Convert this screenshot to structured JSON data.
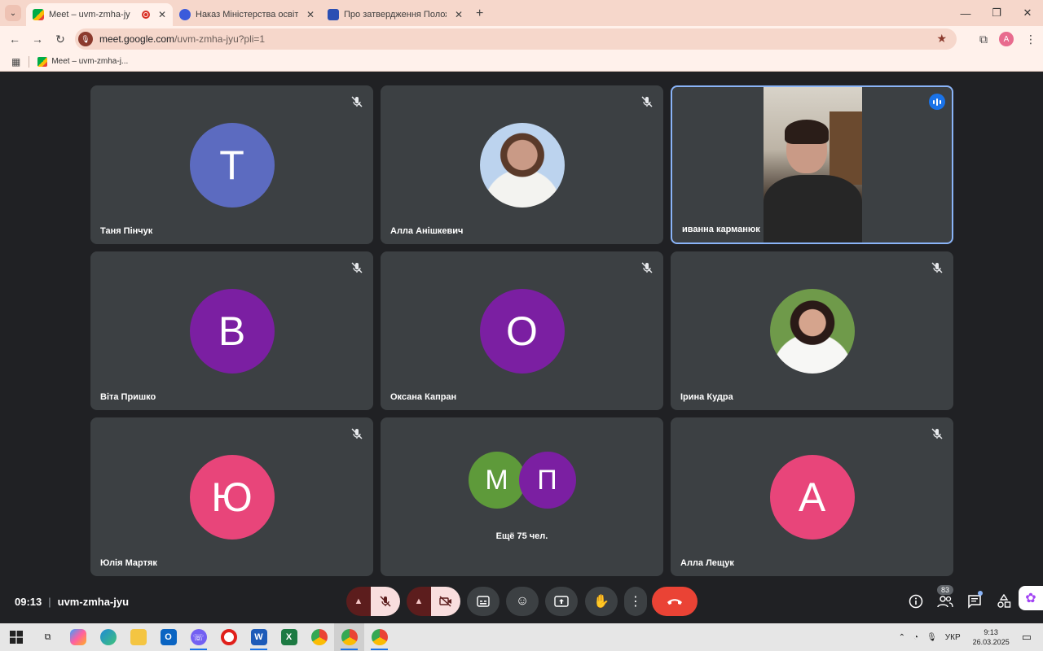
{
  "browser": {
    "tabs": [
      {
        "title": "Meet – uvm-zmha-jyu",
        "active": true,
        "favicon_color": "#00ac47"
      },
      {
        "title": "Наказ Міністерства освіти і на",
        "active": false,
        "favicon_color": "#3b5bdb"
      },
      {
        "title": "Про затвердження Положен",
        "active": false,
        "favicon_color": "#2b4fb3"
      }
    ],
    "new_tab": "+",
    "url_host": "meet.google.com",
    "url_path": "/uvm-zmha-jyu?pli=1",
    "profile_initial": "A",
    "bookmark": "Meet – uvm-zmha-j..."
  },
  "meeting": {
    "time": "09:13",
    "code": "uvm-zmha-jyu",
    "participants_count": "83",
    "more_label": "Ещё 75 чел.",
    "tiles": [
      {
        "name": "Таня Пінчук",
        "initial": "Т",
        "color": "#5c6bc0",
        "kind": "initial"
      },
      {
        "name": "Алла Анішкевич",
        "kind": "photo"
      },
      {
        "name": "иванна карманюк",
        "kind": "video"
      },
      {
        "name": "Віта Пришко",
        "initial": "В",
        "color": "#7b1fa2",
        "kind": "initial"
      },
      {
        "name": "Оксана Капран",
        "initial": "О",
        "color": "#7b1fa2",
        "kind": "initial"
      },
      {
        "name": "Ірина Кудра",
        "kind": "photo"
      },
      {
        "name": "Юлія Мартяк",
        "initial": "Ю",
        "color": "#e8457a",
        "kind": "initial"
      },
      {
        "name": "",
        "kind": "more",
        "pair": [
          {
            "initial": "М",
            "color": "#5e9a3a"
          },
          {
            "initial": "П",
            "color": "#7b1fa2"
          }
        ]
      },
      {
        "name": "Алла Лещук",
        "initial": "А",
        "color": "#e8457a",
        "kind": "initial"
      }
    ]
  },
  "taskbar": {
    "language": "УКР",
    "time": "9:13",
    "date": "26.03.2025"
  }
}
